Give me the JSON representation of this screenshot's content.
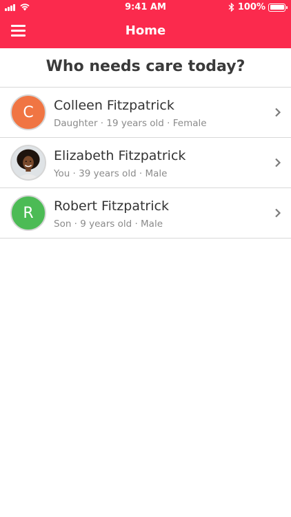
{
  "status_bar": {
    "time": "9:41 AM",
    "battery": "100%"
  },
  "header": {
    "title": "Home",
    "background_color": "#fb2a4d",
    "menu_icon": "hamburger-menu-icon"
  },
  "question": "Who needs care today?",
  "people": [
    {
      "name": "Colleen Fitzpatrick",
      "details": "Daughter · 19 years old · Female",
      "avatar_initial": "C",
      "avatar_color": "#f07543"
    },
    {
      "name": "Elizabeth Fitzpatrick",
      "details": "You · 39 years old · Male",
      "avatar_type": "photo"
    },
    {
      "name": "Robert Fitzpatrick",
      "details": "Son · 9 years old · Male",
      "avatar_initial": "R",
      "avatar_color": "#4cbb55"
    }
  ]
}
